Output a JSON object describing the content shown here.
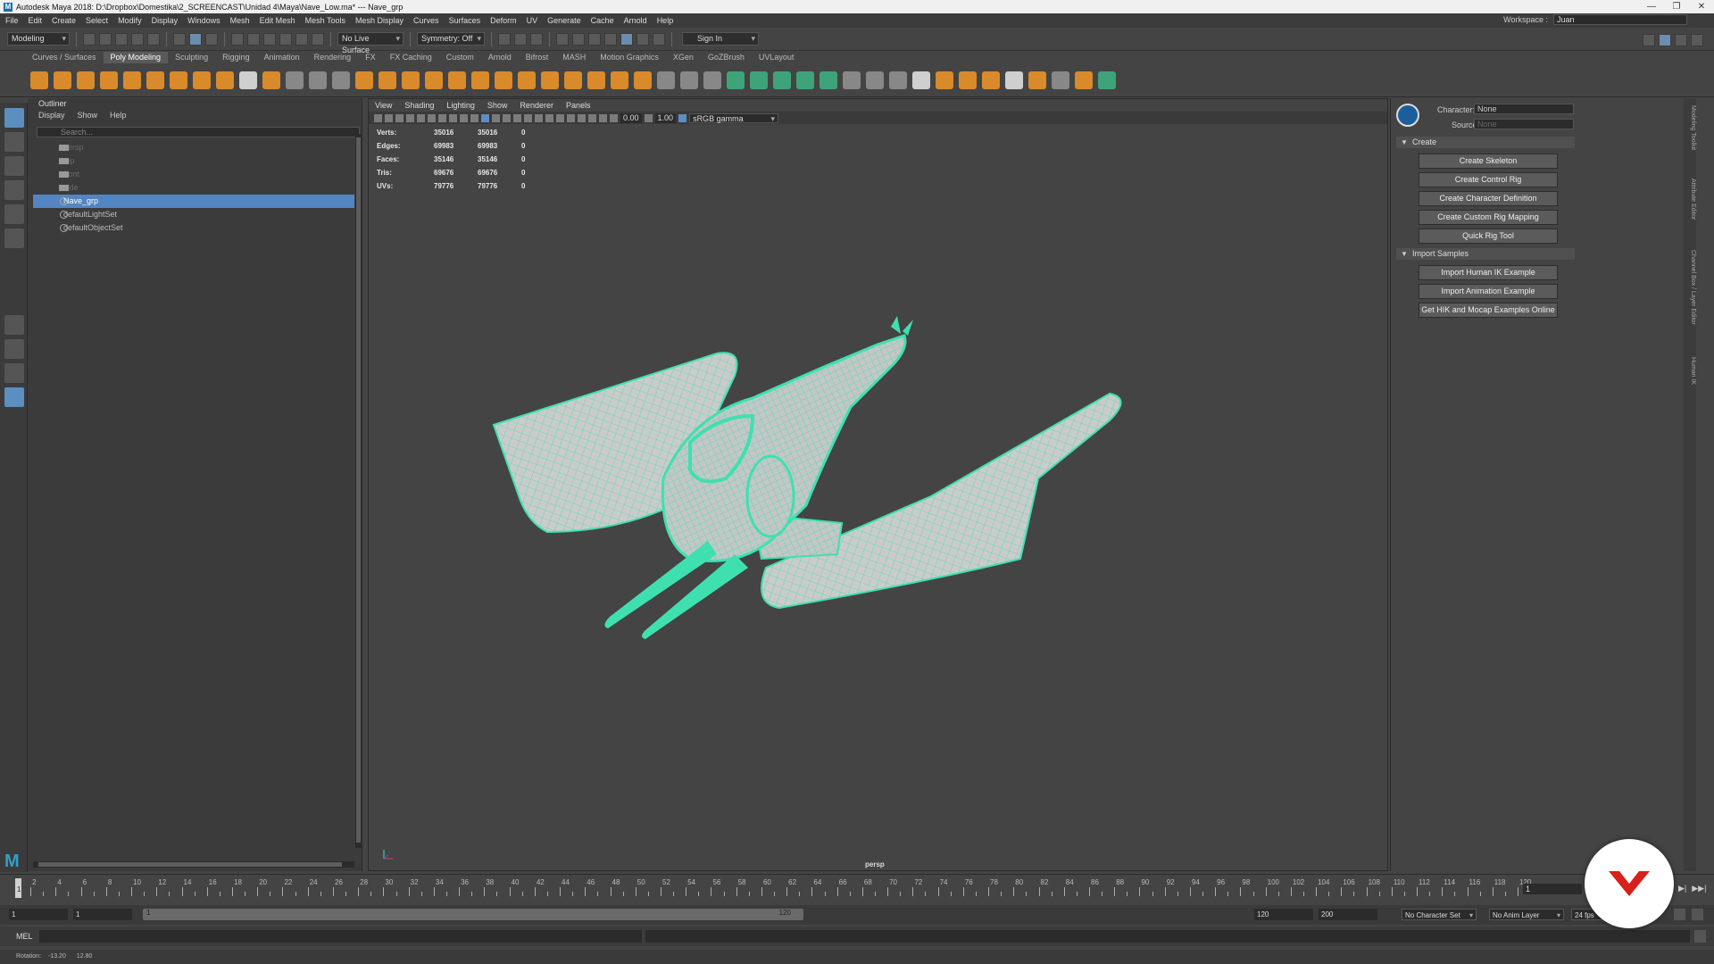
{
  "window": {
    "title": "Autodesk Maya 2018: D:\\Dropbox\\Domestika\\2_SCREENCAST\\Unidad 4\\Maya\\Nave_Low.ma*   ---   Nave_grp",
    "controls": [
      "—",
      "❐",
      "✕"
    ]
  },
  "menubar": [
    "File",
    "Edit",
    "Create",
    "Select",
    "Modify",
    "Display",
    "Windows",
    "Mesh",
    "Edit Mesh",
    "Mesh Tools",
    "Mesh Display",
    "Curves",
    "Surfaces",
    "Deform",
    "UV",
    "Generate",
    "Cache",
    "Arnold",
    "Help"
  ],
  "workspace": {
    "label": "Workspace :",
    "value": "Juan"
  },
  "statusline": {
    "mode": "Modeling",
    "live_surface": "No Live Surface",
    "symmetry": "Symmetry: Off",
    "sign_in": "Sign In"
  },
  "shelf_tabs": [
    "Curves / Surfaces",
    "Poly Modeling",
    "Sculpting",
    "Rigging",
    "Animation",
    "Rendering",
    "FX",
    "FX Caching",
    "Custom",
    "Arnold",
    "Bifrost",
    "MASH",
    "Motion Graphics",
    "XGen",
    "GoZBrush",
    "UVLayout"
  ],
  "shelf_active": "Poly Modeling",
  "outliner": {
    "title": "Outliner",
    "menu": [
      "Display",
      "Show",
      "Help"
    ],
    "search_placeholder": "Search...",
    "items": [
      {
        "label": "persp",
        "type": "camera",
        "state": "dim"
      },
      {
        "label": "top",
        "type": "camera",
        "state": "dim"
      },
      {
        "label": "front",
        "type": "camera",
        "state": "dim"
      },
      {
        "label": "side",
        "type": "camera",
        "state": "dim"
      },
      {
        "label": "Nave_grp",
        "type": "group",
        "state": "selected"
      },
      {
        "label": "defaultLightSet",
        "type": "set",
        "state": "normal"
      },
      {
        "label": "defaultObjectSet",
        "type": "set",
        "state": "normal"
      }
    ]
  },
  "viewport": {
    "menu": [
      "View",
      "Shading",
      "Lighting",
      "Show",
      "Renderer",
      "Panels"
    ],
    "exposure": "0.00",
    "gamma": "1.00",
    "colorspace": "sRGB gamma",
    "camera": "persp",
    "hud": [
      {
        "label": "Verts:",
        "a": "35016",
        "b": "35016",
        "c": "0"
      },
      {
        "label": "Edges:",
        "a": "69983",
        "b": "69983",
        "c": "0"
      },
      {
        "label": "Faces:",
        "a": "35146",
        "b": "35146",
        "c": "0"
      },
      {
        "label": "Tris:",
        "a": "69676",
        "b": "69676",
        "c": "0"
      },
      {
        "label": "UVs:",
        "a": "79776",
        "b": "79776",
        "c": "0"
      }
    ],
    "mesh_color": "#3fe0b0"
  },
  "humanik": {
    "character_label": "Character:",
    "character_value": "None",
    "source_label": "Source:",
    "source_value": "None",
    "create_section": "Create",
    "create_buttons": [
      "Create Skeleton",
      "Create Control Rig",
      "Create Character Definition",
      "Create Custom Rig Mapping",
      "Quick Rig Tool"
    ],
    "import_section": "Import Samples",
    "import_buttons": [
      "Import Human IK Example",
      "Import Animation Example",
      "Get HIK and Mocap Examples Online"
    ],
    "side_tabs": [
      "Modeling Toolkit",
      "Attribute Editor",
      "Channel Box / Layer Editor",
      "Human IK"
    ]
  },
  "timeline": {
    "ticks": [
      "2",
      "4",
      "6",
      "8",
      "10",
      "12",
      "14",
      "16",
      "18",
      "20",
      "22",
      "24",
      "26",
      "28",
      "30",
      "32",
      "34",
      "36",
      "38",
      "40",
      "42",
      "44",
      "46",
      "48",
      "50",
      "52",
      "54",
      "56",
      "58",
      "60",
      "62",
      "64",
      "66",
      "68",
      "70",
      "72",
      "74",
      "76",
      "78",
      "80",
      "82",
      "84",
      "86",
      "88",
      "90",
      "92",
      "94",
      "96",
      "98",
      "100",
      "102",
      "104",
      "106",
      "108",
      "110",
      "112",
      "114",
      "116",
      "118",
      "120"
    ],
    "current": "1",
    "frame_field": "1"
  },
  "range": {
    "start": "1",
    "start2": "1",
    "bar_start": "1",
    "bar_end": "120",
    "end": "120",
    "end2": "200",
    "character_set": "No Character Set",
    "anim_layer": "No Anim Layer",
    "fps": "24 fps"
  },
  "mel": {
    "label": "MEL"
  },
  "helpline": {
    "rotation_label": "Rotation:",
    "rot_x": "-13.20",
    "rot_y": "12.80"
  }
}
